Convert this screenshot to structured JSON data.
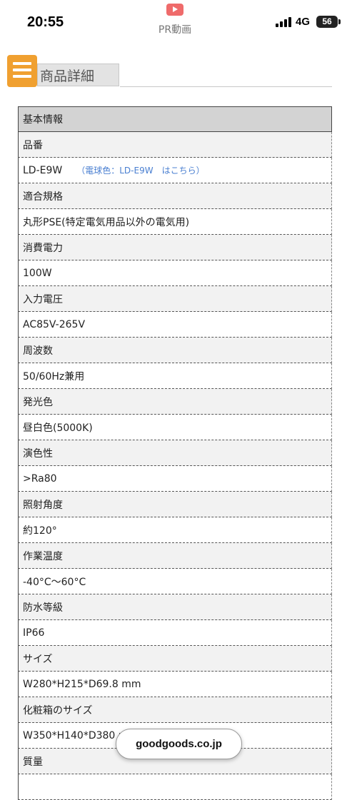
{
  "status_bar": {
    "time": "20:55",
    "pr_label": "PR動画",
    "network": "4G",
    "battery": "56"
  },
  "header": {
    "title": "商品詳細",
    "menu_icon": "hamburger-menu-icon",
    "accent_color": "#f0a030"
  },
  "spec_table": {
    "section_title": "基本情報",
    "rows": [
      {
        "label": "品番",
        "value": "LD-E9W",
        "note": "（電球色：LD-E9W　はこちら）"
      },
      {
        "label": "適合規格",
        "value": "丸形PSE(特定電気用品以外の電気用)"
      },
      {
        "label": "消費電力",
        "value": "100W"
      },
      {
        "label": "入力電圧",
        "value": "AC85V-265V"
      },
      {
        "label": "周波数",
        "value": "50/60Hz兼用"
      },
      {
        "label": "発光色",
        "value": "昼白色(5000K)"
      },
      {
        "label": "演色性",
        "value": ">Ra80"
      },
      {
        "label": "照射角度",
        "value": "約120°"
      },
      {
        "label": "作業温度",
        "value": "-40°C〜60°C"
      },
      {
        "label": "防水等級",
        "value": "IP66"
      },
      {
        "label": "サイズ",
        "value": "W280*H215*D69.8 mm"
      },
      {
        "label": "化粧箱のサイズ",
        "value": "W350*H140*D380 mm"
      },
      {
        "label": "質量",
        "value": ""
      }
    ]
  },
  "site_badge": "goodgoods.co.jp"
}
